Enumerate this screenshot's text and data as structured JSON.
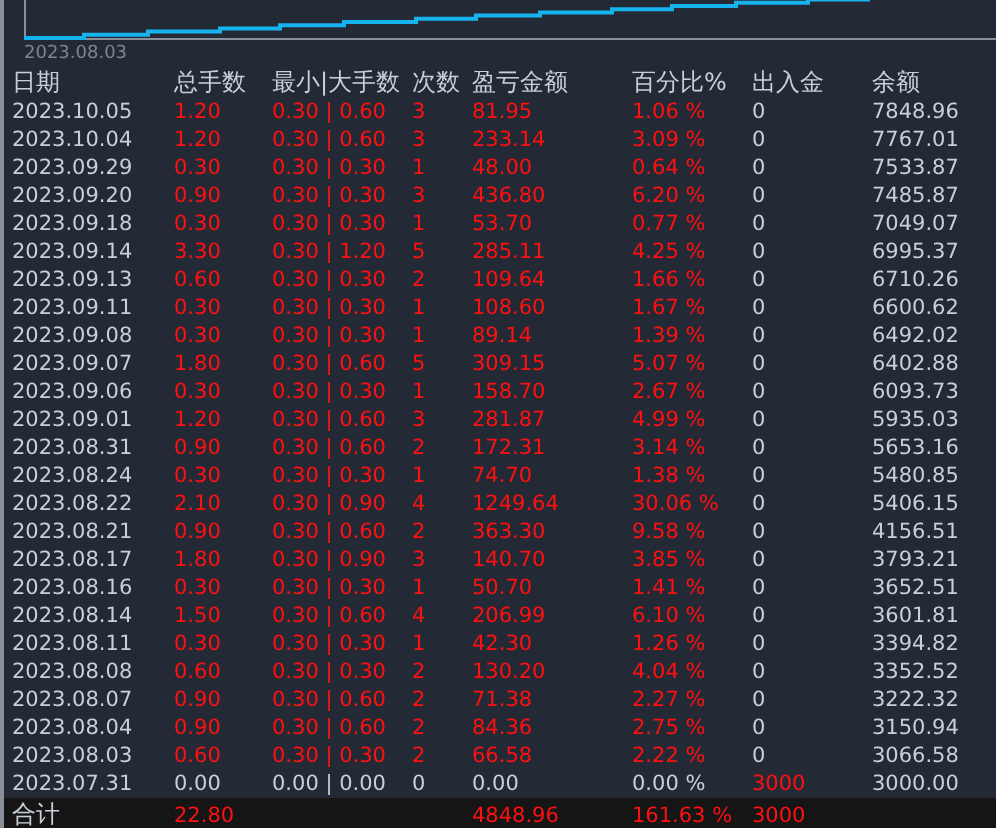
{
  "chart": {
    "x_label": "2023.08.03"
  },
  "table": {
    "columns": [
      "日期",
      "总手数",
      "最小|大手数",
      "次数",
      "盈亏金额",
      "百分比%",
      "出入金",
      "余额"
    ],
    "rows": [
      {
        "kind": "trade",
        "cells": [
          "2023.10.05",
          "1.20",
          "0.30 | 0.60",
          "3",
          "81.95",
          "1.06 %",
          "0",
          "7848.96"
        ]
      },
      {
        "kind": "trade",
        "cells": [
          "2023.10.04",
          "1.20",
          "0.30 | 0.60",
          "3",
          "233.14",
          "3.09 %",
          "0",
          "7767.01"
        ]
      },
      {
        "kind": "trade",
        "cells": [
          "2023.09.29",
          "0.30",
          "0.30 | 0.30",
          "1",
          "48.00",
          "0.64 %",
          "0",
          "7533.87"
        ]
      },
      {
        "kind": "trade",
        "cells": [
          "2023.09.20",
          "0.90",
          "0.30 | 0.30",
          "3",
          "436.80",
          "6.20 %",
          "0",
          "7485.87"
        ]
      },
      {
        "kind": "trade",
        "cells": [
          "2023.09.18",
          "0.30",
          "0.30 | 0.30",
          "1",
          "53.70",
          "0.77 %",
          "0",
          "7049.07"
        ]
      },
      {
        "kind": "trade",
        "cells": [
          "2023.09.14",
          "3.30",
          "0.30 | 1.20",
          "5",
          "285.11",
          "4.25 %",
          "0",
          "6995.37"
        ]
      },
      {
        "kind": "trade",
        "cells": [
          "2023.09.13",
          "0.60",
          "0.30 | 0.30",
          "2",
          "109.64",
          "1.66 %",
          "0",
          "6710.26"
        ]
      },
      {
        "kind": "trade",
        "cells": [
          "2023.09.11",
          "0.30",
          "0.30 | 0.30",
          "1",
          "108.60",
          "1.67 %",
          "0",
          "6600.62"
        ]
      },
      {
        "kind": "trade",
        "cells": [
          "2023.09.08",
          "0.30",
          "0.30 | 0.30",
          "1",
          "89.14",
          "1.39 %",
          "0",
          "6492.02"
        ]
      },
      {
        "kind": "trade",
        "cells": [
          "2023.09.07",
          "1.80",
          "0.30 | 0.60",
          "5",
          "309.15",
          "5.07 %",
          "0",
          "6402.88"
        ]
      },
      {
        "kind": "trade",
        "cells": [
          "2023.09.06",
          "0.30",
          "0.30 | 0.30",
          "1",
          "158.70",
          "2.67 %",
          "0",
          "6093.73"
        ]
      },
      {
        "kind": "trade",
        "cells": [
          "2023.09.01",
          "1.20",
          "0.30 | 0.60",
          "3",
          "281.87",
          "4.99 %",
          "0",
          "5935.03"
        ]
      },
      {
        "kind": "trade",
        "cells": [
          "2023.08.31",
          "0.90",
          "0.30 | 0.60",
          "2",
          "172.31",
          "3.14 %",
          "0",
          "5653.16"
        ]
      },
      {
        "kind": "trade",
        "cells": [
          "2023.08.24",
          "0.30",
          "0.30 | 0.30",
          "1",
          "74.70",
          "1.38 %",
          "0",
          "5480.85"
        ]
      },
      {
        "kind": "trade",
        "cells": [
          "2023.08.22",
          "2.10",
          "0.30 | 0.90",
          "4",
          "1249.64",
          "30.06 %",
          "0",
          "5406.15"
        ]
      },
      {
        "kind": "trade",
        "cells": [
          "2023.08.21",
          "0.90",
          "0.30 | 0.60",
          "2",
          "363.30",
          "9.58 %",
          "0",
          "4156.51"
        ]
      },
      {
        "kind": "trade",
        "cells": [
          "2023.08.17",
          "1.80",
          "0.30 | 0.90",
          "3",
          "140.70",
          "3.85 %",
          "0",
          "3793.21"
        ]
      },
      {
        "kind": "trade",
        "cells": [
          "2023.08.16",
          "0.30",
          "0.30 | 0.30",
          "1",
          "50.70",
          "1.41 %",
          "0",
          "3652.51"
        ]
      },
      {
        "kind": "trade",
        "cells": [
          "2023.08.14",
          "1.50",
          "0.30 | 0.60",
          "4",
          "206.99",
          "6.10 %",
          "0",
          "3601.81"
        ]
      },
      {
        "kind": "trade",
        "cells": [
          "2023.08.11",
          "0.30",
          "0.30 | 0.30",
          "1",
          "42.30",
          "1.26 %",
          "0",
          "3394.82"
        ]
      },
      {
        "kind": "trade",
        "cells": [
          "2023.08.08",
          "0.60",
          "0.30 | 0.30",
          "2",
          "130.20",
          "4.04 %",
          "0",
          "3352.52"
        ]
      },
      {
        "kind": "trade",
        "cells": [
          "2023.08.07",
          "0.90",
          "0.30 | 0.60",
          "2",
          "71.38",
          "2.27 %",
          "0",
          "3222.32"
        ]
      },
      {
        "kind": "trade",
        "cells": [
          "2023.08.04",
          "0.90",
          "0.30 | 0.60",
          "2",
          "84.36",
          "2.75 %",
          "0",
          "3150.94"
        ]
      },
      {
        "kind": "trade",
        "cells": [
          "2023.08.03",
          "0.60",
          "0.30 | 0.30",
          "2",
          "66.58",
          "2.22 %",
          "0",
          "3066.58"
        ]
      },
      {
        "kind": "deposit",
        "cells": [
          "2023.07.31",
          "0.00",
          "0.00 | 0.00",
          "0",
          "0.00",
          "0.00 %",
          "3000",
          "3000.00"
        ]
      }
    ],
    "total": {
      "label": "合计",
      "lots": "22.80",
      "profit": "4848.96",
      "percent": "161.63 %",
      "in_out": "3000"
    }
  }
}
